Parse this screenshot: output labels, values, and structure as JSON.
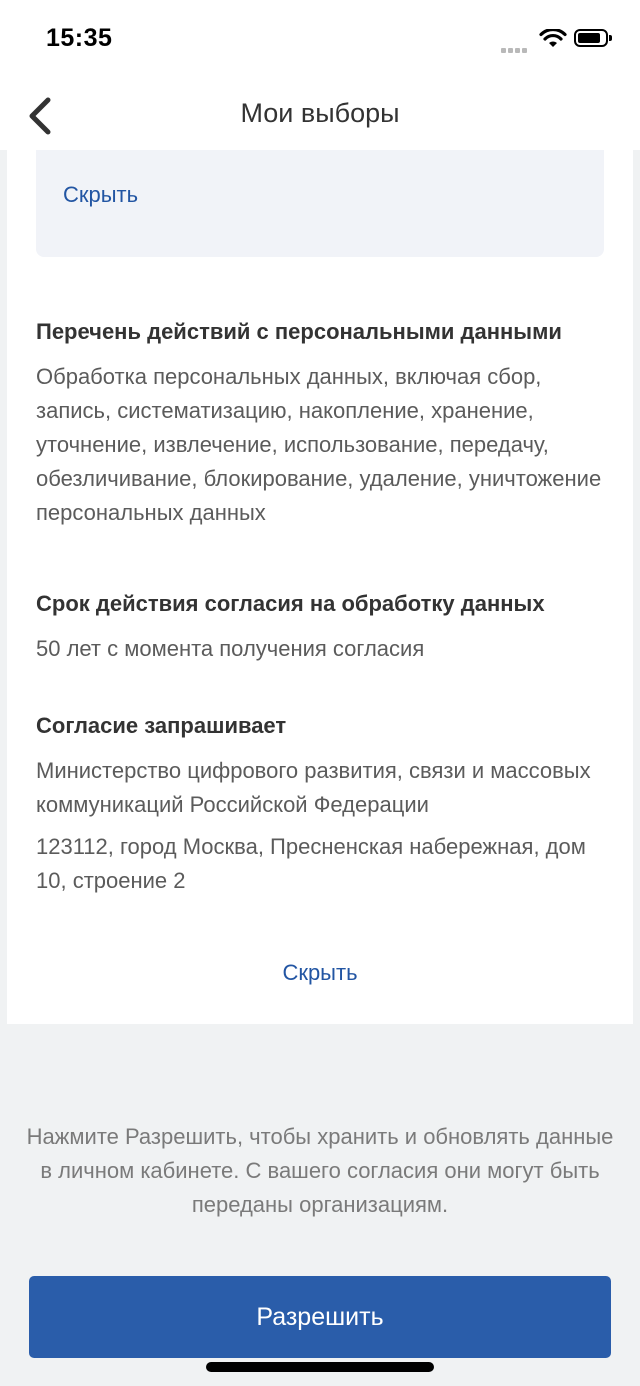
{
  "status_bar": {
    "time": "15:35"
  },
  "nav": {
    "title": "Мои выборы",
    "back_icon": "chevron-left-icon"
  },
  "top_hide_link": "Скрыть",
  "sections": [
    {
      "heading": "Перечень действий с персональными данными",
      "text": "Обработка персональных данных, включая сбор, запись, систематизацию, накопление, хранение, уточнение, извлечение, использование, передачу, обезличивание, блокирование, удаление, уничтожение персональных данных"
    },
    {
      "heading": "Срок действия согласия на обработку данных",
      "text": "50 лет с момента получения согласия"
    },
    {
      "heading": "Согласие запрашивает",
      "text": "Министерство цифрового развития, связи и массовых коммуникаций Российской Федерации",
      "address": "123112, город Москва, Пресненская набережная, дом 10, строение 2"
    }
  ],
  "bottom_hide_link": "Скрыть",
  "info_text": "Нажмите Разрешить, чтобы хранить и обновлять данные в личном кабинете. С вашего согласия они могут быть переданы организациям.",
  "allow_button": "Разрешить",
  "colors": {
    "accent": "#2a5daa",
    "link": "#2255a3",
    "background": "#f0f2f3"
  }
}
